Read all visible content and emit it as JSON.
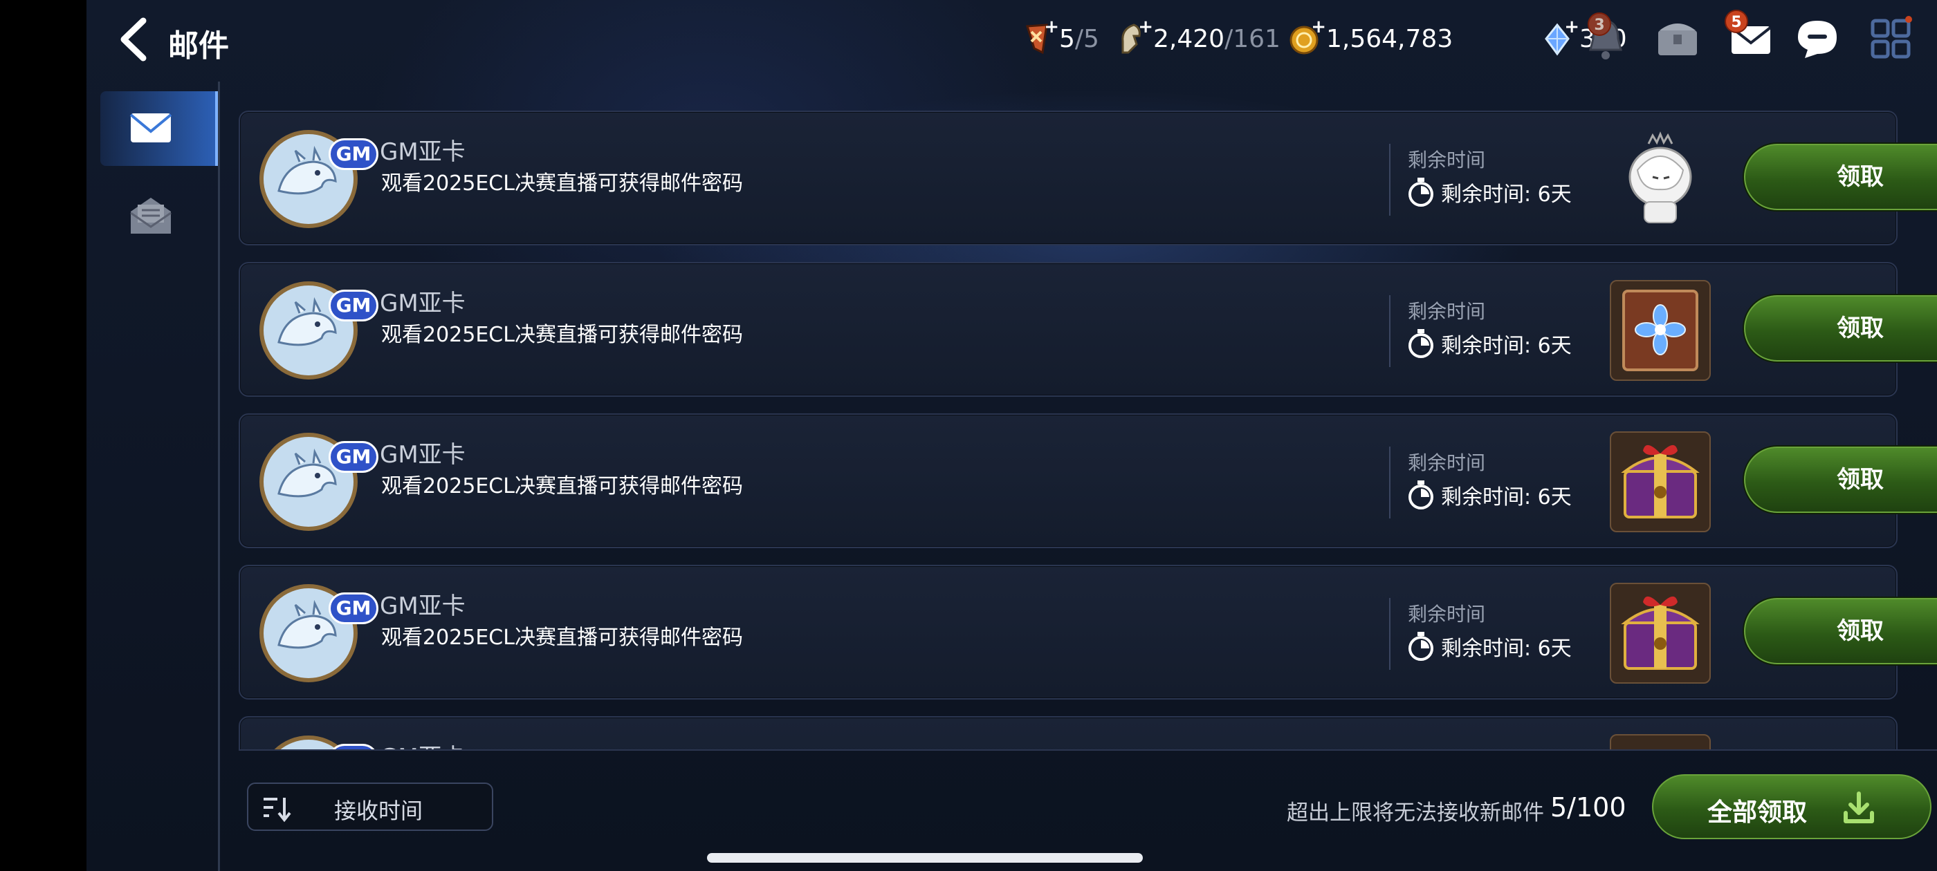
{
  "header": {
    "title": "邮件",
    "resources": [
      {
        "icon": "stamina-icon",
        "value": "5",
        "max": "/5"
      },
      {
        "icon": "horse-ticket-icon",
        "value": "2,420",
        "max": "/161"
      },
      {
        "icon": "gold-coin-icon",
        "value": "1,564,783",
        "max": ""
      },
      {
        "icon": "crystal-icon",
        "value": "300",
        "max": ""
      }
    ],
    "notification_badge": "3",
    "mail_badge": "5"
  },
  "sidebar": {
    "tabs": [
      {
        "name": "inbox",
        "icon": "mail-icon",
        "active": true
      },
      {
        "name": "read",
        "icon": "opened-mail-icon",
        "active": false
      }
    ]
  },
  "mails": [
    {
      "sender": "GM亚卡",
      "subject": "观看2025ECL决赛直播可获得邮件密码",
      "remain_label": "剩余时间",
      "remain": "剩余时间: 6天",
      "item": "chibi-character-icon",
      "claim": "领取"
    },
    {
      "sender": "GM亚卡",
      "subject": "观看2025ECL决赛直播可获得邮件密码",
      "remain_label": "剩余时间",
      "remain": "剩余时间: 6天",
      "item": "flower-book-icon",
      "claim": "领取"
    },
    {
      "sender": "GM亚卡",
      "subject": "观看2025ECL决赛直播可获得邮件密码",
      "remain_label": "剩余时间",
      "remain": "剩余时间: 6天",
      "item": "gift-chest-icon",
      "claim": "领取"
    },
    {
      "sender": "GM亚卡",
      "subject": "观看2025ECL决赛直播可获得邮件密码",
      "remain_label": "剩余时间",
      "remain": "剩余时间: 6天",
      "item": "gift-chest-icon",
      "claim": "领取"
    },
    {
      "sender": "GM亚卡",
      "subject": "",
      "remain_label": "",
      "remain": "",
      "item": "gift-chest-icon",
      "claim": ""
    }
  ],
  "gm_tag": "GM",
  "footer": {
    "sort_label": "接收时间",
    "limit_text": "超出上限将无法接收新邮件",
    "limit_count": "5/100",
    "claim_all": "全部领取"
  }
}
